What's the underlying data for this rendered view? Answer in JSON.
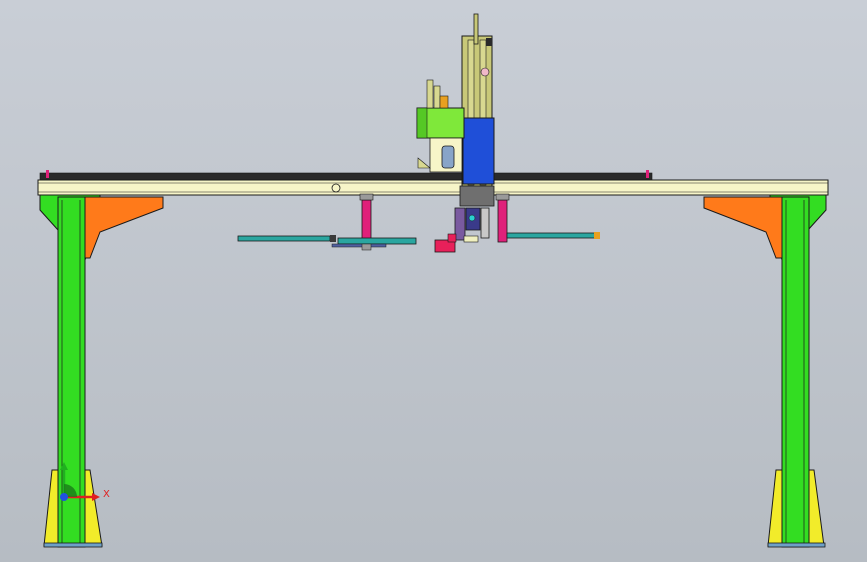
{
  "viewport": {
    "background_top": "#c9ced6",
    "background_bottom": "#b6bcc3"
  },
  "triad": {
    "x_label": "X",
    "x_color": "#e02020",
    "y_color": "#20b020",
    "z_color": "#2050e0"
  },
  "colors": {
    "beam": "#f7f5c8",
    "column": "#33dd22",
    "bracket": "#ff7a1a",
    "foot": "#f2ec2a",
    "carriage_blue": "#1f4fd8",
    "rail_olive": "#c8c878",
    "green_box": "#7fe83a",
    "magenta": "#e0207a",
    "teal_arm": "#2aa6a0",
    "red_block": "#e8205a",
    "outline": "#1a1a1a"
  }
}
